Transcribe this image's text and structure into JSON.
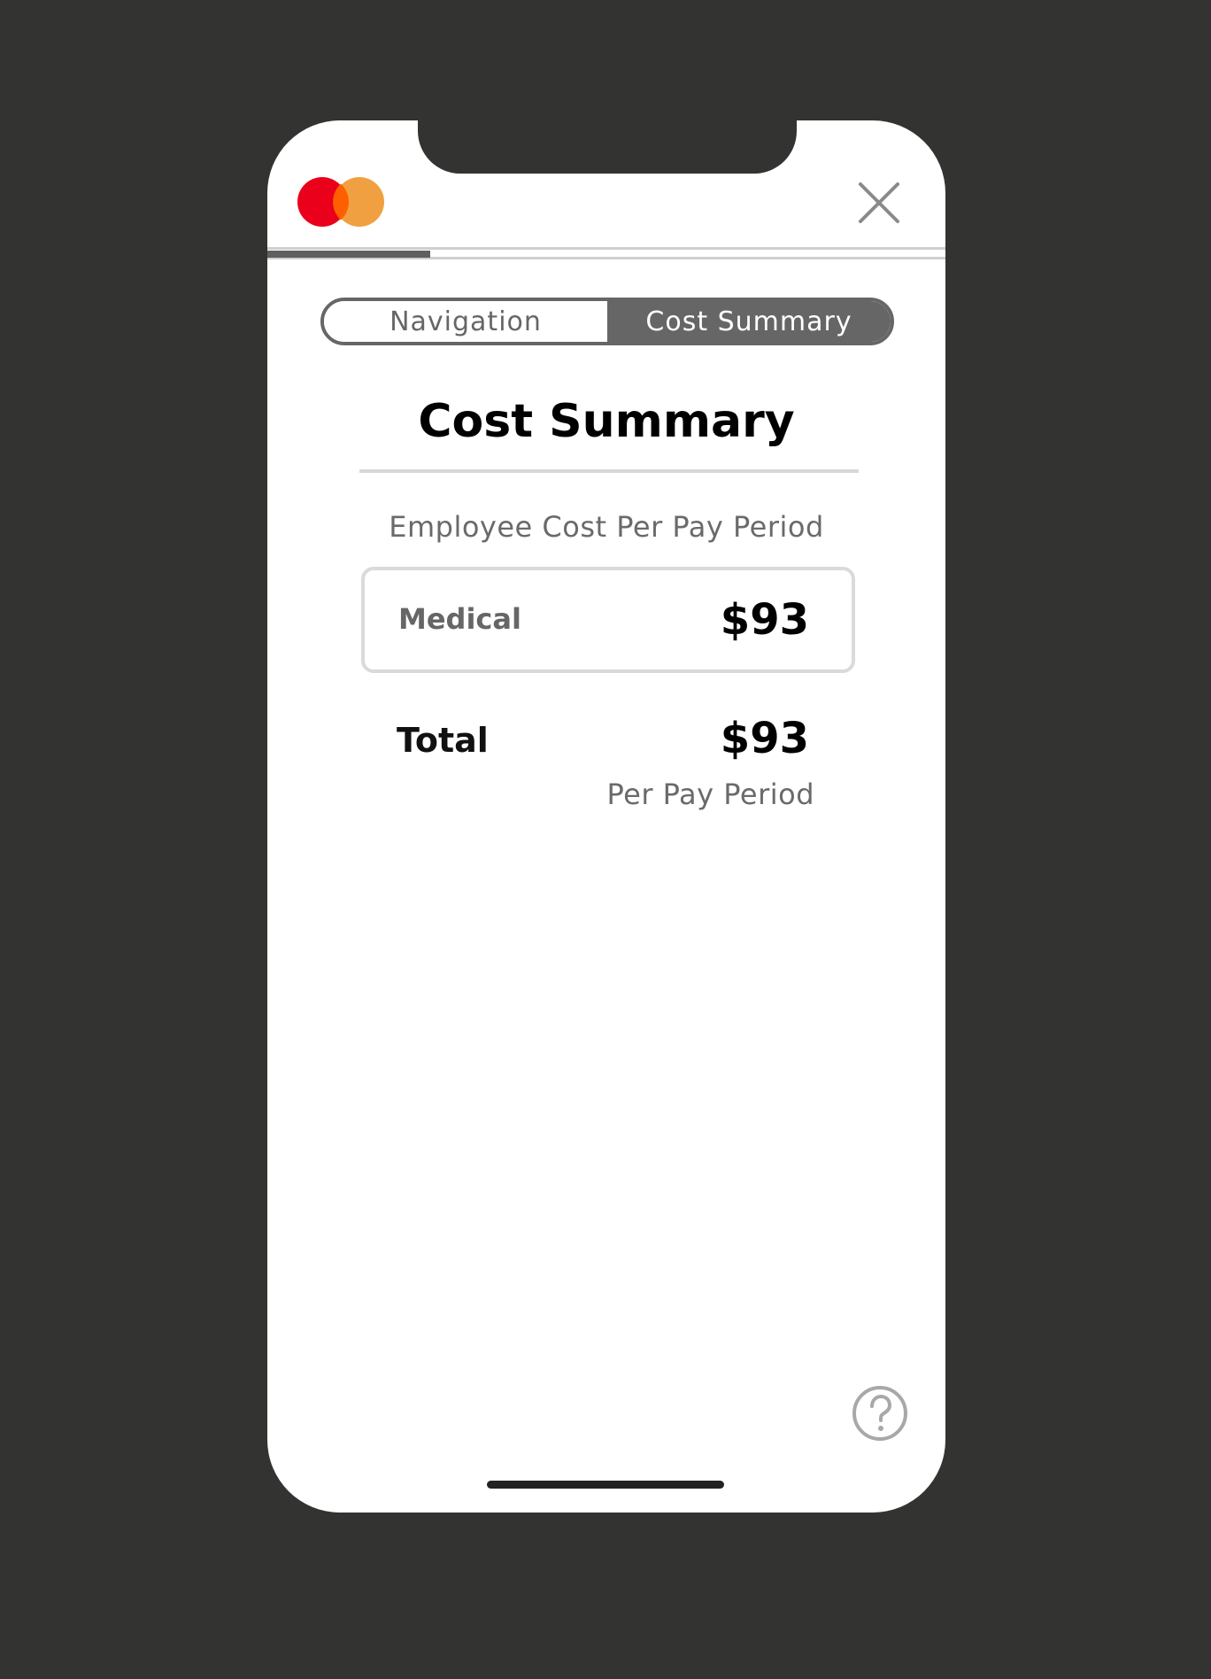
{
  "header": {
    "logo_icon": "mastercard-logo",
    "close_icon": "close-icon",
    "progress_fraction": 0.24
  },
  "tabs": [
    {
      "label": "Navigation",
      "active": false
    },
    {
      "label": "Cost Summary",
      "active": true
    }
  ],
  "summary": {
    "title": "Cost Summary",
    "subtitle": "Employee Cost Per Pay Period",
    "items": [
      {
        "label": "Medical",
        "value": "$93"
      }
    ],
    "total_label": "Total",
    "total_value": "$93",
    "total_note": "Per Pay Period"
  },
  "footer": {
    "help_icon": "help-icon"
  },
  "colors": {
    "background": "#333332",
    "logo_red": "#eb001b",
    "logo_orange": "#f79e1b",
    "active_tab": "#666666"
  }
}
